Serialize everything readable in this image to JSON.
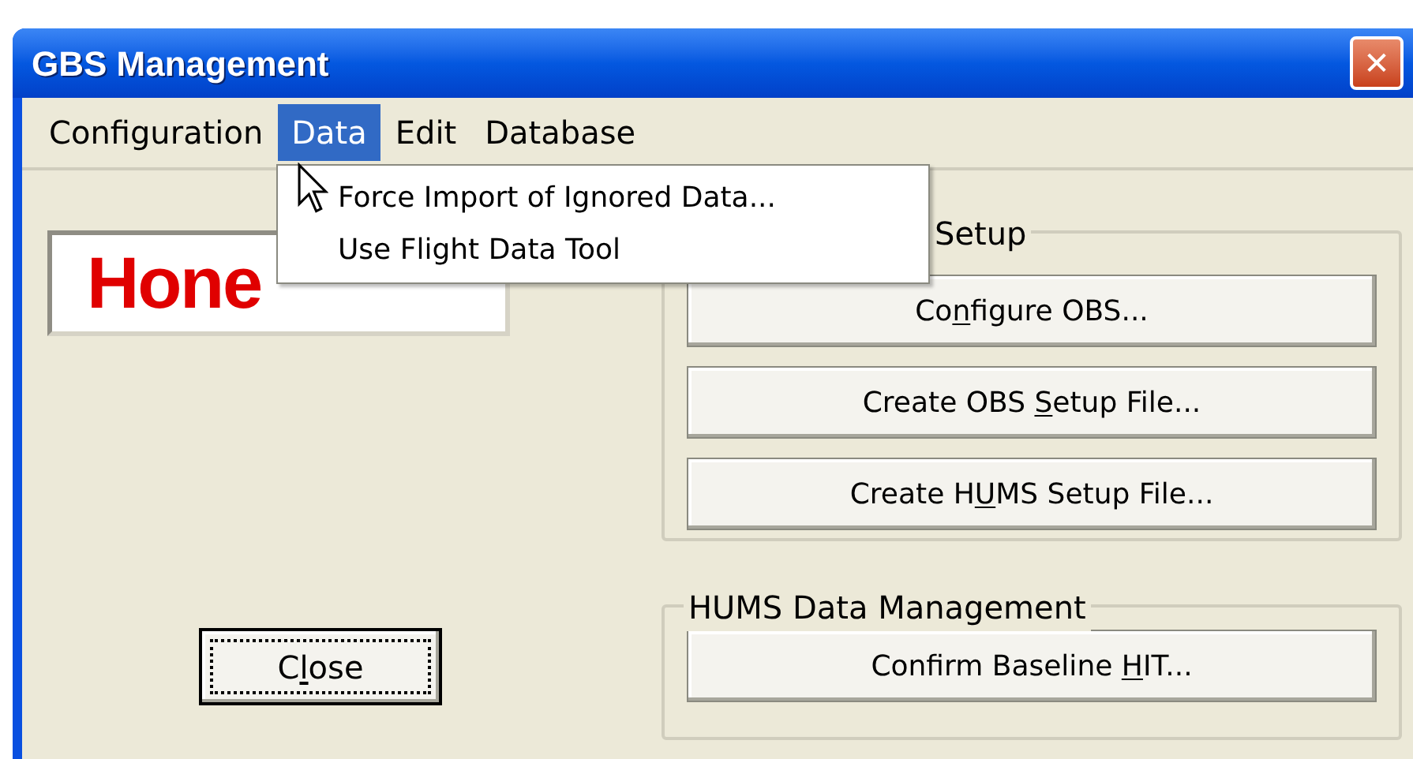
{
  "window": {
    "title": "GBS Management",
    "close_glyph": "✕"
  },
  "menu_bar": [
    {
      "label": "Configuration",
      "selected": false
    },
    {
      "label": "Data",
      "selected": true
    },
    {
      "label": "Edit",
      "selected": false
    },
    {
      "label": "Database",
      "selected": false
    }
  ],
  "open_menu": {
    "items": [
      "Force Import of Ignored Data...",
      "Use Flight Data Tool"
    ]
  },
  "logo": {
    "text": "Hone"
  },
  "setup_group": {
    "label": "Setup",
    "buttons": [
      {
        "before": "Co",
        "key": "n",
        "after": "figure OBS..."
      },
      {
        "before": "Create OBS ",
        "key": "S",
        "after": "etup File..."
      },
      {
        "before": "Create H",
        "key": "U",
        "after": "MS Setup File..."
      }
    ]
  },
  "hums_group": {
    "label": "HUMS Data Management",
    "buttons": [
      {
        "before": "Confirm Baseline ",
        "key": "H",
        "after": "IT..."
      }
    ]
  },
  "close_button": {
    "before": "C",
    "key": "l",
    "after": "ose",
    "focused": true
  }
}
